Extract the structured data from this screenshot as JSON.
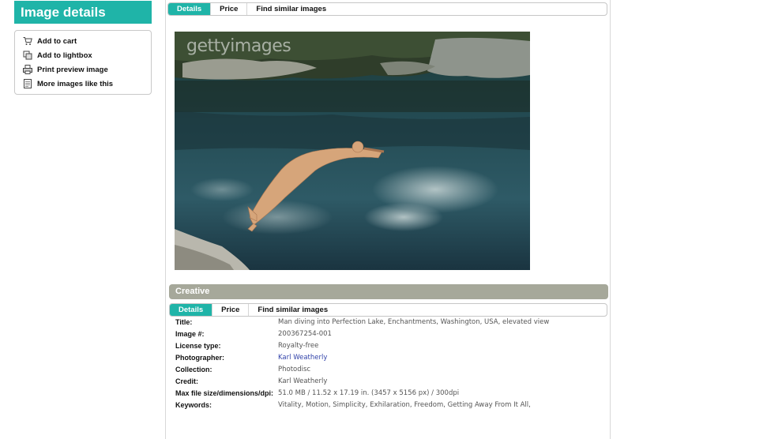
{
  "sidebar": {
    "title": "Image details",
    "items": [
      {
        "label": "Add to cart",
        "icon": "cart-icon"
      },
      {
        "label": "Add to lightbox",
        "icon": "lightbox-icon"
      },
      {
        "label": "Print preview image",
        "icon": "printer-icon"
      },
      {
        "label": "More images like this",
        "icon": "document-icon"
      }
    ]
  },
  "top_tabs": [
    {
      "label": "Details",
      "active": true
    },
    {
      "label": "Price",
      "active": false
    },
    {
      "label": "Find similar images",
      "active": false
    }
  ],
  "image": {
    "watermark": "gettyimages"
  },
  "section": {
    "title": "Creative"
  },
  "lower_tabs": [
    {
      "label": "Details",
      "active": true
    },
    {
      "label": "Price",
      "active": false
    },
    {
      "label": "Find similar images",
      "active": false
    }
  ],
  "details": [
    {
      "key": "Title:",
      "value": "Man diving into Perfection Lake, Enchantments, Washington, USA, elevated view"
    },
    {
      "key": "Image #:",
      "value": "200367254-001"
    },
    {
      "key": "License type:",
      "value": "Royalty-free"
    },
    {
      "key": "Photographer:",
      "value": "Karl Weatherly"
    },
    {
      "key": "Collection:",
      "value": "Photodisc"
    },
    {
      "key": "Credit:",
      "value": "Karl Weatherly"
    },
    {
      "key": "Max file size/dimensions/dpi:",
      "value": "51.0 MB / 11.52 x 17.19 in. (3457 x 5156 px) / 300dpi"
    },
    {
      "key": "Keywords:",
      "value": "Vitality, Motion, Simplicity, Exhilaration, Freedom, Getting Away From It All,"
    }
  ],
  "colors": {
    "accent": "#1fb4a8",
    "section_bar": "#a6a89a",
    "link": "#3344aa"
  }
}
